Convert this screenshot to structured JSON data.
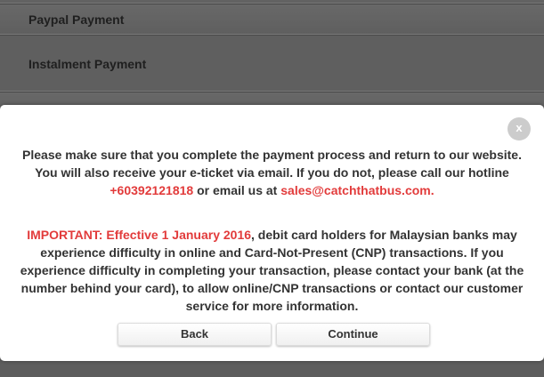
{
  "background": {
    "payment_options": [
      {
        "label": "Paypal Payment"
      },
      {
        "label": "Instalment Payment"
      }
    ]
  },
  "modal": {
    "close_label": "x",
    "message_1": {
      "part_1": "Please make sure that you complete the payment process and return to our website. You will also receive your e-ticket via email. If you do not, please call our hotline",
      "hotline": "+60392121818",
      "part_2": "or email us at",
      "email": "sales@catchthatbus.com."
    },
    "message_2": {
      "important": "IMPORTANT: Effective 1 January 2016",
      "body": ", debit card holders for Malaysian banks may experience difficulty in online and Card-Not-Present (CNP) transactions. If you experience difficulty in completing your transaction, please contact your bank (at the number behind your card), to allow online/CNP transactions or contact our customer service for more information."
    },
    "buttons": {
      "back_label": "Back",
      "continue_label": "Continue"
    }
  },
  "colors": {
    "accent_red": "#e23b3b",
    "overlay": "#5e5e5e"
  }
}
